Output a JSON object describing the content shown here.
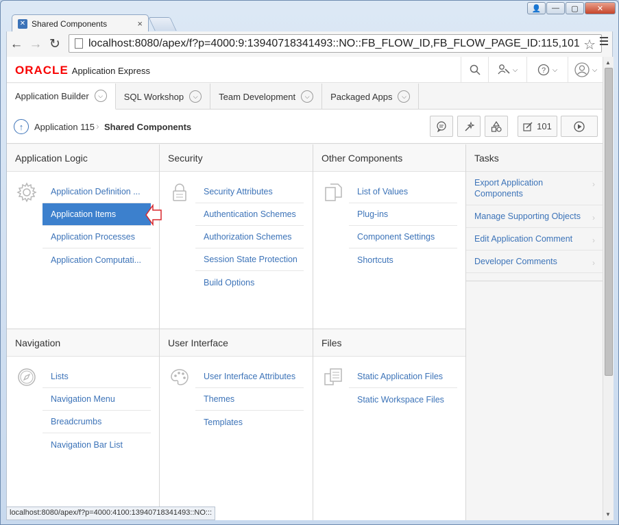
{
  "browser": {
    "tab_title": "Shared Components",
    "url": "localhost:8080/apex/f?p=4000:9:13940718341493::NO::FB_FLOW_ID,FB_FLOW_PAGE_ID:115,101",
    "status_url": "localhost:8080/apex/f?p=4000:4100:13940718341493::NO:::"
  },
  "header": {
    "brand": "ORACLE",
    "product": "Application Express"
  },
  "main_tabs": [
    {
      "label": "Application Builder"
    },
    {
      "label": "SQL Workshop"
    },
    {
      "label": "Team Development"
    },
    {
      "label": "Packaged Apps"
    }
  ],
  "breadcrumb": {
    "parent": "Application 115",
    "current": "Shared Components"
  },
  "toolbar": {
    "page_number": "101"
  },
  "regions": {
    "app_logic": {
      "title": "Application Logic",
      "items": [
        "Application Definition ...",
        "Application Items",
        "Application Processes",
        "Application Computati..."
      ]
    },
    "security": {
      "title": "Security",
      "items": [
        "Security Attributes",
        "Authentication Schemes",
        "Authorization Schemes",
        "Session State Protection",
        "Build Options"
      ]
    },
    "other": {
      "title": "Other Components",
      "items": [
        "List of Values",
        "Plug-ins",
        "Component Settings",
        "Shortcuts"
      ]
    },
    "navigation": {
      "title": "Navigation",
      "items": [
        "Lists",
        "Navigation Menu",
        "Breadcrumbs",
        "Navigation Bar List"
      ]
    },
    "ui": {
      "title": "User Interface",
      "items": [
        "User Interface Attributes",
        "Themes",
        "Templates"
      ]
    },
    "files": {
      "title": "Files",
      "items": [
        "Static Application Files",
        "Static Workspace Files"
      ]
    }
  },
  "tasks": {
    "title": "Tasks",
    "items": [
      "Export Application Components",
      "Manage Supporting Objects",
      "Edit Application Comment",
      "Developer Comments"
    ]
  },
  "colors": {
    "accent": "#3c73b8",
    "selected_bg": "#3c80cd",
    "oracle_red": "#f80000"
  }
}
